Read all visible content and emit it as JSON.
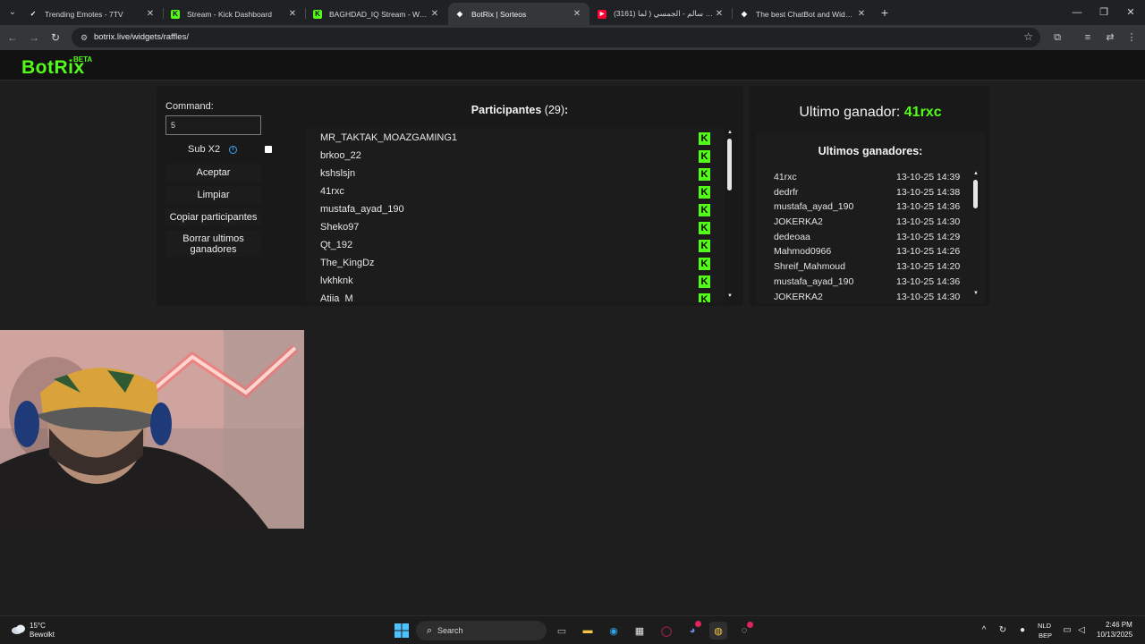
{
  "browser": {
    "tabs": [
      {
        "title": "Trending Emotes - 7TV",
        "icon": "7tv-icon",
        "active": false
      },
      {
        "title": "Stream - Kick Dashboard",
        "icon": "kick-icon",
        "active": false
      },
      {
        "title": "BAGHDAD_IQ Stream - Watch Live",
        "icon": "kick-icon",
        "active": false
      },
      {
        "title": "BotRix | Sorteos",
        "icon": "botrix-icon",
        "active": true
      },
      {
        "title": "(3161) سليم سالم - الجمسي ( لما",
        "icon": "youtube-icon",
        "active": false
      },
      {
        "title": "The best ChatBot and Widgets",
        "icon": "botrix-icon",
        "active": false
      }
    ],
    "url": "botrix.live/widgets/raffles/"
  },
  "site": {
    "logo": "BotRix",
    "logo_badge": "BETA"
  },
  "controls": {
    "command_label": "Command:",
    "command_value": "5",
    "subx2_label": "Sub X2",
    "subx2_checked": false,
    "buttons": {
      "accept": "Aceptar",
      "clear": "Limpiar",
      "copy": "Copiar participantes",
      "delete_winners": "Borrar ultimos ganadores"
    }
  },
  "participants": {
    "title": "Participantes",
    "count": "(29)",
    "colon": ":",
    "list": [
      "MR_TAKTAK_MOAZGAMING1",
      "brkoo_22",
      "kshslsjn",
      "41rxc",
      "mustafa_ayad_190",
      "Sheko97",
      "Qt_192",
      "The_KingDz",
      "lvkhknk",
      "Atiia_M"
    ]
  },
  "winner": {
    "label": "Ultimo ganador:",
    "name": "41rxc"
  },
  "last_winners": {
    "title": "Ultimos ganadores:",
    "list": [
      {
        "name": "41rxc",
        "date": "13-10-25 14:39"
      },
      {
        "name": "dedrfr",
        "date": "13-10-25 14:38"
      },
      {
        "name": "mustafa_ayad_190",
        "date": "13-10-25 14:36"
      },
      {
        "name": "JOKERKA2",
        "date": "13-10-25 14:30"
      },
      {
        "name": "dedeoaa",
        "date": "13-10-25 14:29"
      },
      {
        "name": "Mahmod0966",
        "date": "13-10-25 14:26"
      },
      {
        "name": "Shreif_Mahmoud",
        "date": "13-10-25 14:20"
      },
      {
        "name": "mustafa_ayad_190",
        "date": "13-10-25 14:36"
      },
      {
        "name": "JOKERKA2",
        "date": "13-10-25 14:30"
      }
    ]
  },
  "taskbar": {
    "weather_temp": "15°C",
    "weather_cond": "Bewolkt",
    "search_placeholder": "Search",
    "lang_top": "NLD",
    "lang_bottom": "BEP",
    "time": "2:46 PM",
    "date": "10/13/2025"
  },
  "colors": {
    "accent": "#53fc18",
    "info": "#3ea6ff",
    "background": "#1e1e1e"
  }
}
